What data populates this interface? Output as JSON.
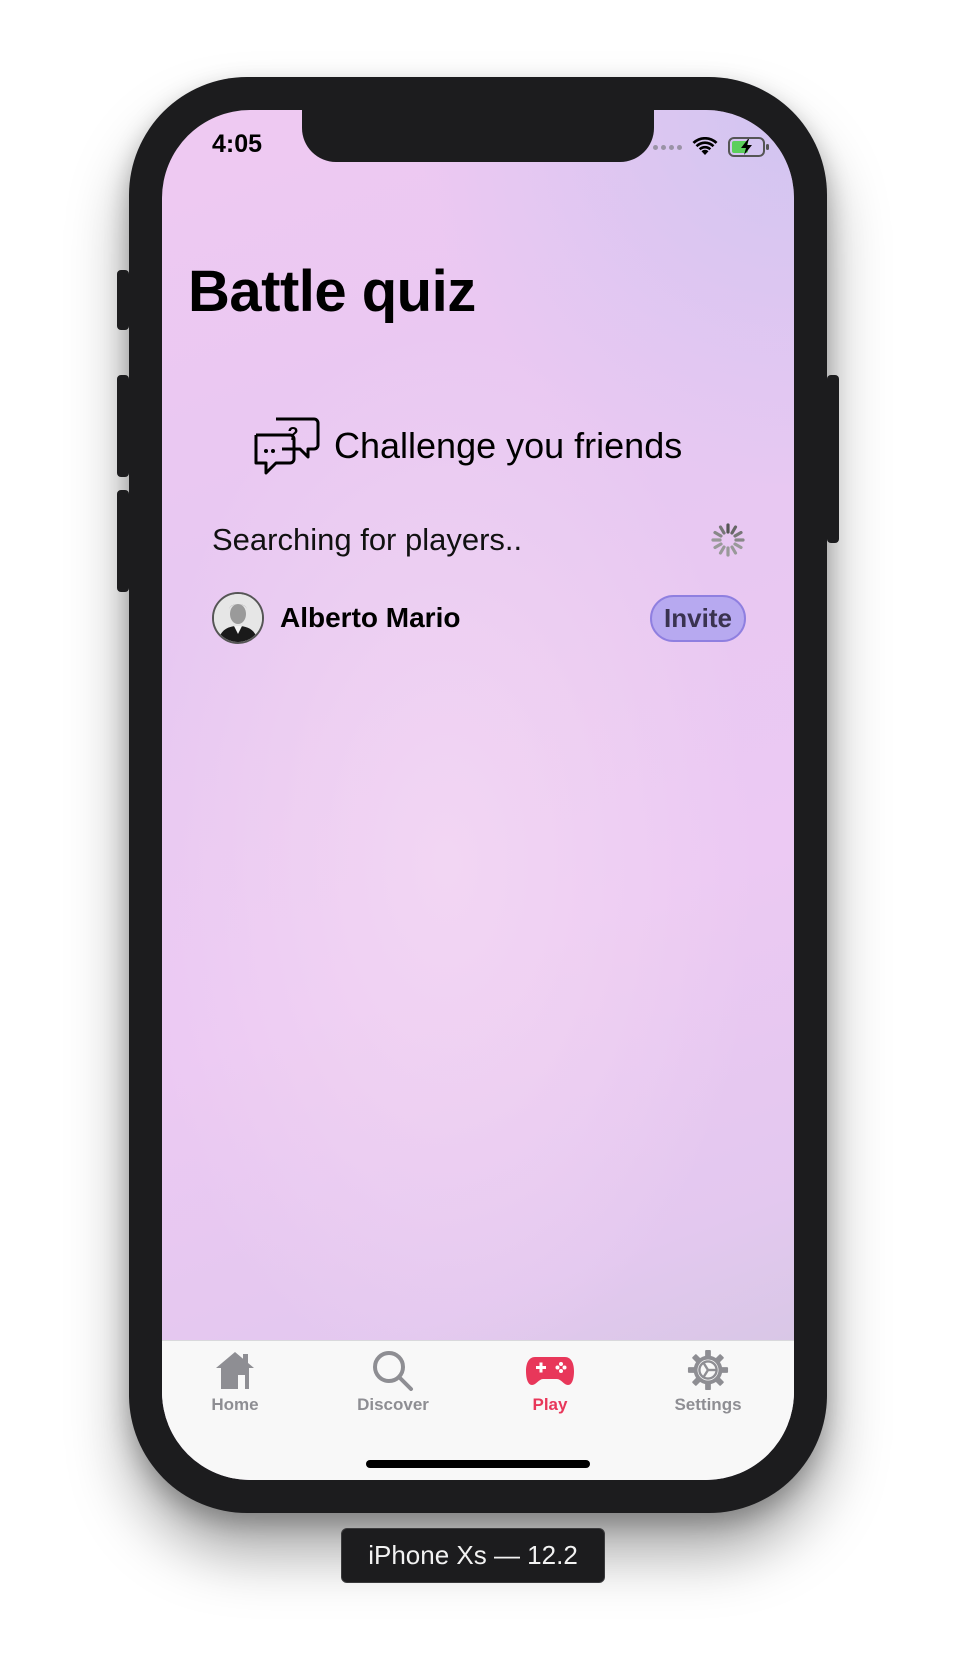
{
  "status_bar": {
    "time": "4:05",
    "icons": [
      "cellular-dots-icon",
      "wifi-icon",
      "battery-charging-icon"
    ]
  },
  "header": {
    "title": "Battle quiz"
  },
  "challenge": {
    "icon": "chat-question-icon",
    "label": "Challenge you friends"
  },
  "search": {
    "label": "Searching for players..",
    "spinner": "activity-spinner-icon"
  },
  "players": [
    {
      "name": "Alberto Mario",
      "action_label": "Invite"
    }
  ],
  "tabbar": {
    "items": [
      {
        "label": "Home",
        "icon": "house-icon",
        "active": false
      },
      {
        "label": "Discover",
        "icon": "magnifier-icon",
        "active": false
      },
      {
        "label": "Play",
        "icon": "gamepad-icon",
        "active": true
      },
      {
        "label": "Settings",
        "icon": "gear-icon",
        "active": false
      }
    ],
    "active_color": "#e8375a",
    "inactive_color": "#8e8e93"
  },
  "simulator_label": "iPhone Xs — 12.2",
  "colors": {
    "invite_bg": "#b7a9f0",
    "invite_border": "#8f7fe0",
    "background_top": "#efc9f2",
    "background_bottom": "#cfc6de"
  }
}
